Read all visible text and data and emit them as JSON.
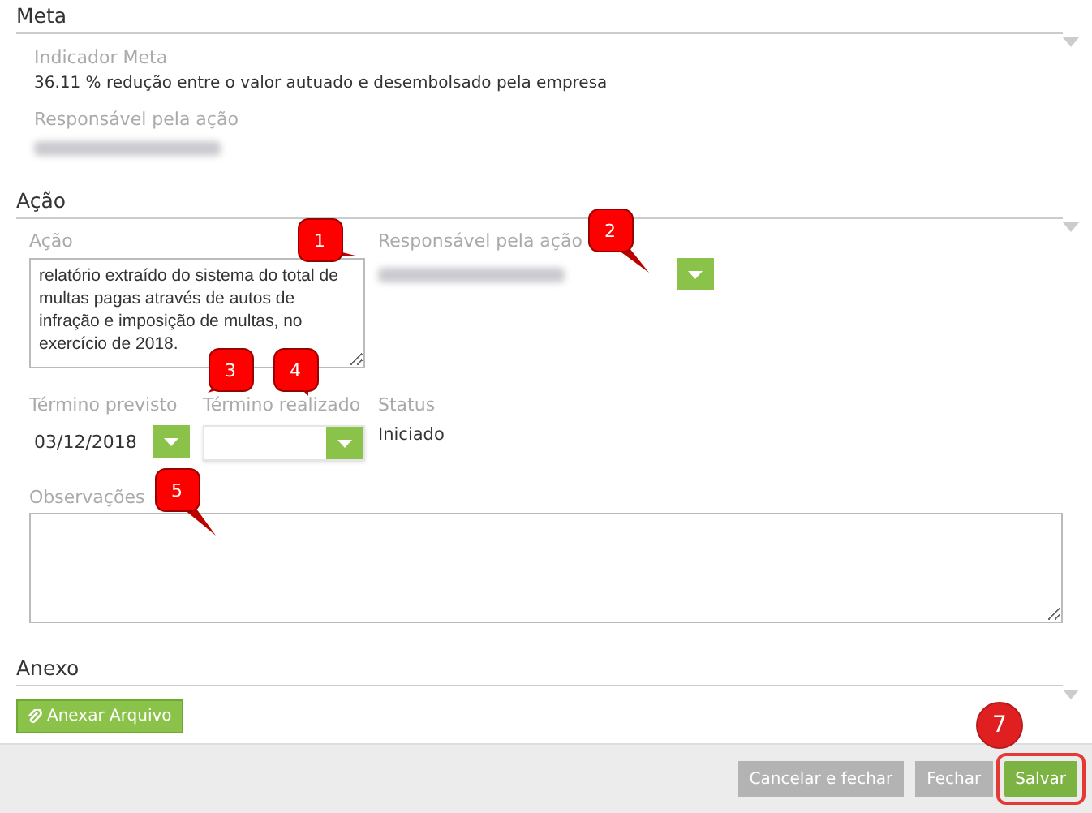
{
  "meta": {
    "title": "Meta",
    "indicator_label": "Indicador Meta",
    "indicator_value": "36.11 % redução entre o valor autuado e desembolsado pela empresa",
    "responsible_label": "Responsável pela ação"
  },
  "acao": {
    "title": "Ação",
    "action_label": "Ação",
    "action_value": "relatório extraído do sistema do total de multas pagas através de autos de infração e imposição de multas, no exercício de 2018.",
    "responsible_label": "Responsável pela ação",
    "planned_end_label": "Término previsto",
    "planned_end_value": "03/12/2018",
    "actual_end_label": "Término realizado",
    "status_label": "Status",
    "status_value": "Iniciado",
    "notes_label": "Observações"
  },
  "anexo": {
    "title": "Anexo",
    "attach_button": "Anexar Arquivo"
  },
  "footer": {
    "buttons": [
      {
        "label": "Cancelar e fechar",
        "kind": "secondary",
        "highlighted": false
      },
      {
        "label": "Fechar",
        "kind": "secondary",
        "highlighted": false
      },
      {
        "label": "Salvar",
        "kind": "primary",
        "highlighted": true
      }
    ]
  },
  "callouts": [
    {
      "label": "1",
      "kind": "square"
    },
    {
      "label": "2",
      "kind": "square"
    },
    {
      "label": "3",
      "kind": "square"
    },
    {
      "label": "4",
      "kind": "square"
    },
    {
      "label": "5",
      "kind": "square"
    },
    {
      "label": "7",
      "kind": "circle"
    }
  ]
}
